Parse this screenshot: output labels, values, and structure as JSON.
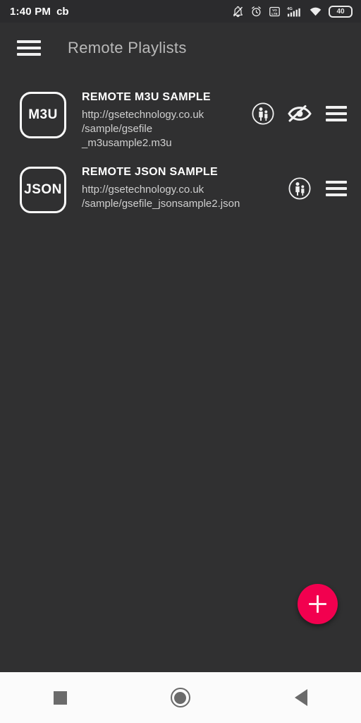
{
  "status_bar": {
    "clock": "1:40 PM",
    "carrier_label": "cb",
    "battery_level": "40",
    "icons": [
      "bell-muted-icon",
      "alarm-clock-icon",
      "volte-icon",
      "signal-4g-icon",
      "wifi-icon",
      "battery-icon"
    ]
  },
  "app_bar": {
    "menu_icon": "hamburger-menu-icon",
    "title": "Remote Playlists"
  },
  "playlists": [
    {
      "badge": "M3U",
      "title": "REMOTE M3U SAMPLE",
      "url": "http://gsetechnology.co.uk\n/sample/gsefile\n_m3usample2.m3u",
      "actions": [
        "parental-control-icon",
        "eye-hidden-icon",
        "row-menu-icon"
      ]
    },
    {
      "badge": "JSON",
      "title": "REMOTE JSON SAMPLE",
      "url": "http://gsetechnology.co.uk\n/sample/gsefile_jsonsample2.json",
      "actions": [
        "parental-control-icon",
        "row-menu-icon"
      ]
    }
  ],
  "fab": {
    "label": "+",
    "name": "add-playlist-button",
    "color": "#f2004f"
  },
  "nav_bar": {
    "recents_label": "recents-square-icon",
    "home_label": "home-circle-icon",
    "back_label": "back-triangle-icon"
  },
  "colors": {
    "background": "#303031",
    "status_bar": "#2b2b2d",
    "accent": "#f2004f",
    "nav_bar": "#fbfbfb",
    "title_text": "#b9b9b9"
  }
}
